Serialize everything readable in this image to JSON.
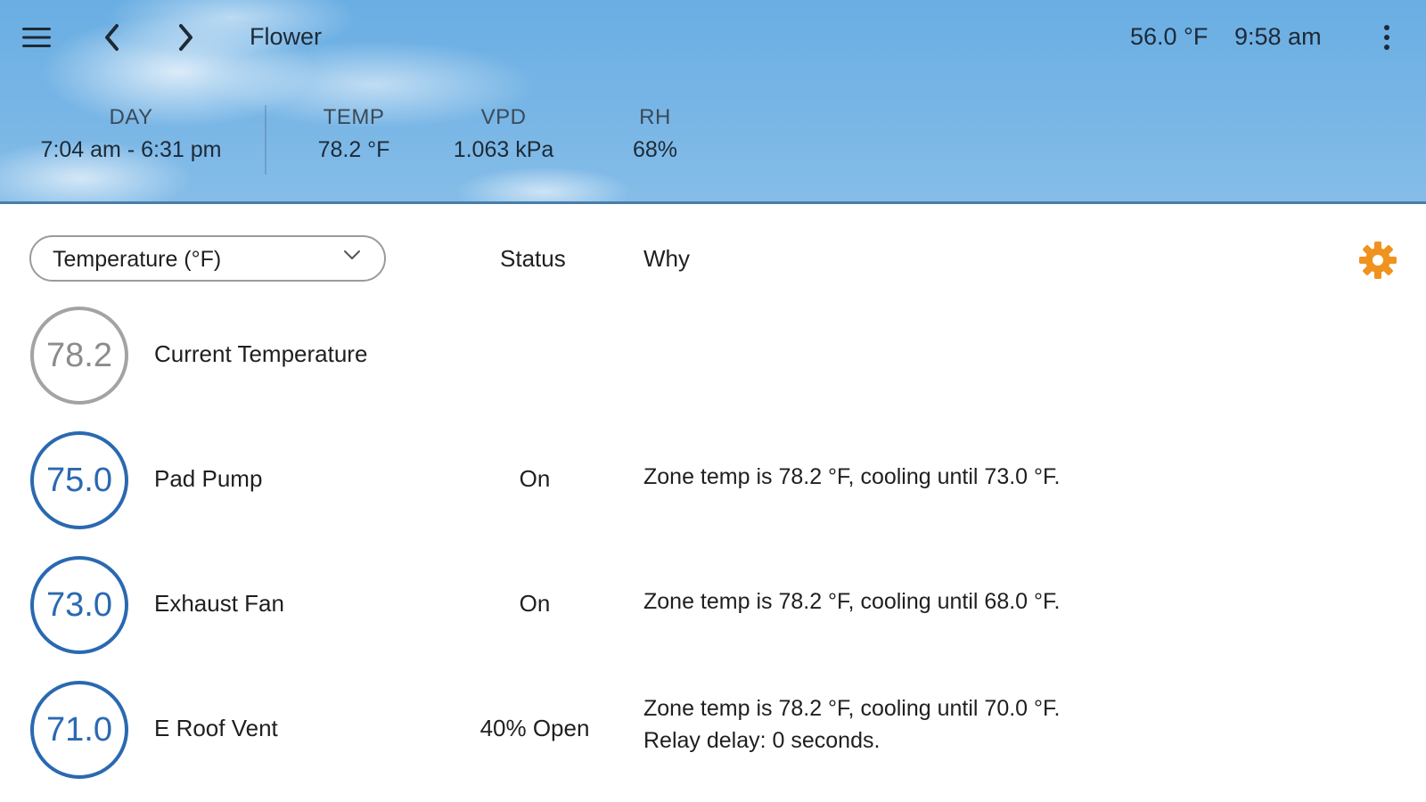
{
  "header": {
    "title": "Flower",
    "outside_temp": "56.0 °F",
    "time": "9:58 am",
    "stats": {
      "day": {
        "label": "DAY",
        "value": "7:04 am - 6:31 pm"
      },
      "temp": {
        "label": "TEMP",
        "value": "78.2 °F"
      },
      "vpd": {
        "label": "VPD",
        "value": "1.063 kPa"
      },
      "rh": {
        "label": "RH",
        "value": "68%"
      }
    },
    "icons": {
      "menu": "hamburger-menu-icon",
      "back": "chevron-left-icon",
      "forward": "chevron-right-icon",
      "more": "more-vertical-icon"
    }
  },
  "toolbar": {
    "sensor_select": "Temperature (°F)",
    "status_header": "Status",
    "why_header": "Why",
    "settings_icon": "gear-icon"
  },
  "colors": {
    "accent_blue": "#2a69b1",
    "gear_orange": "#f0921e",
    "neutral_gray": "#a3a3a3",
    "sky_blue": "#6aaee3"
  },
  "rows": [
    {
      "setpoint": "78.2",
      "name": "Current Temperature",
      "status": "",
      "why": "",
      "why2": ""
    },
    {
      "setpoint": "75.0",
      "name": "Pad Pump",
      "status": "On",
      "why": "Zone temp is 78.2 °F, cooling until 73.0 °F.",
      "why2": ""
    },
    {
      "setpoint": "73.0",
      "name": "Exhaust Fan",
      "status": "On",
      "why": "Zone temp is 78.2 °F, cooling until 68.0 °F.",
      "why2": ""
    },
    {
      "setpoint": "71.0",
      "name": "E Roof Vent",
      "status": "40% Open",
      "why": "Zone temp is 78.2 °F, cooling until 70.0 °F.",
      "why2": "Relay delay: 0 seconds."
    }
  ]
}
